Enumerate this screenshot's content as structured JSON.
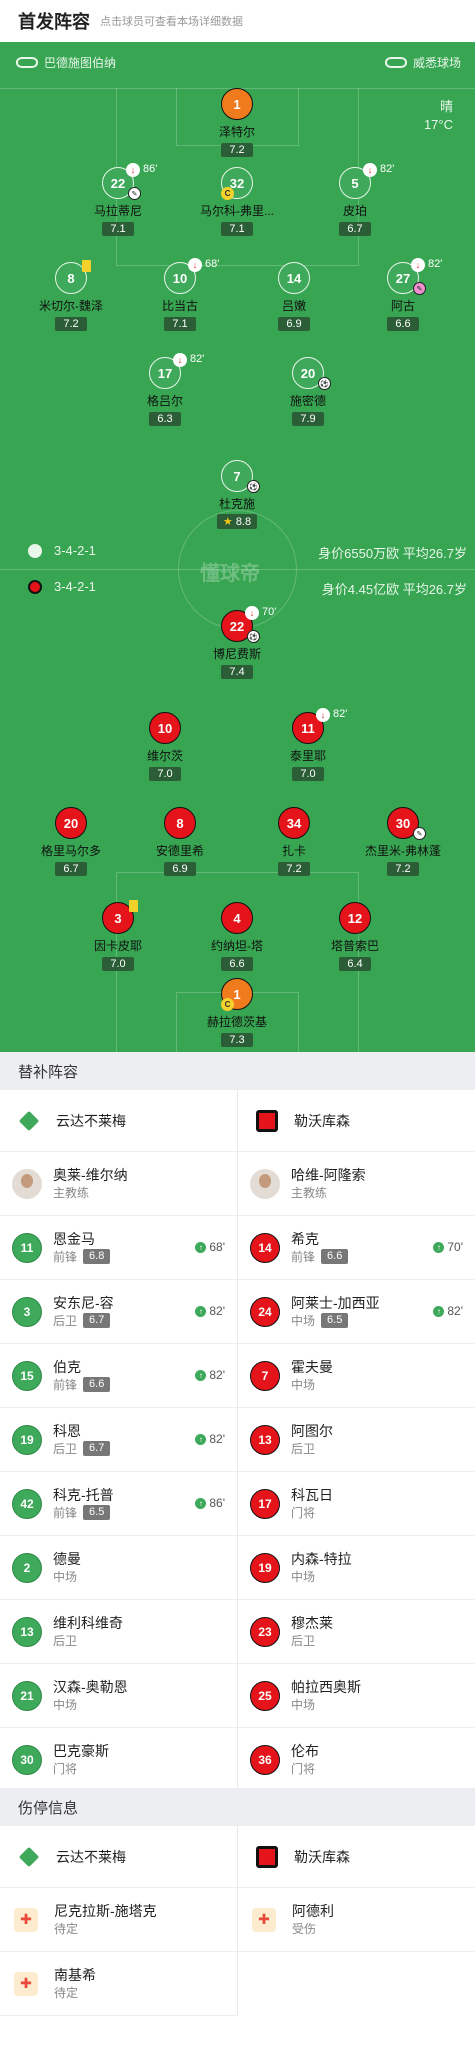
{
  "header": {
    "title": "首发阵容",
    "subtitle": "点击球员可查看本场详细数据"
  },
  "pitch": {
    "home_venue": "巴德施图伯纳",
    "away_venue": "威悉球场",
    "weather": "晴",
    "temperature": "17°C",
    "watermark": "懂球帝",
    "home_formation": "3-4-2-1",
    "away_formation": "3-4-2-1",
    "home_stats": "身价6550万欧 平均26.7岁",
    "away_stats": "身价4.45亿欧 平均26.7岁"
  },
  "home_lineup": [
    {
      "num": "1",
      "name": "泽特尔",
      "rating": "7.2"
    },
    {
      "num": "22",
      "name": "马拉蒂尼",
      "rating": "7.1",
      "sub": "86'"
    },
    {
      "num": "32",
      "name": "马尔科-弗里...",
      "rating": "7.1"
    },
    {
      "num": "5",
      "name": "皮珀",
      "rating": "6.7",
      "sub": "82'"
    },
    {
      "num": "8",
      "name": "米切尔-魏泽",
      "rating": "7.2"
    },
    {
      "num": "10",
      "name": "比当古",
      "rating": "7.1",
      "sub": "68'"
    },
    {
      "num": "14",
      "name": "吕嫩",
      "rating": "6.9"
    },
    {
      "num": "27",
      "name": "阿古",
      "rating": "6.6",
      "sub": "82'"
    },
    {
      "num": "17",
      "name": "格吕尔",
      "rating": "6.3",
      "sub": "82'"
    },
    {
      "num": "20",
      "name": "施密德",
      "rating": "7.9"
    },
    {
      "num": "7",
      "name": "杜克施",
      "rating": "8.8"
    }
  ],
  "away_lineup": [
    {
      "num": "22",
      "name": "博尼费斯",
      "rating": "7.4",
      "sub": "70'"
    },
    {
      "num": "10",
      "name": "维尔茨",
      "rating": "7.0"
    },
    {
      "num": "11",
      "name": "泰里耶",
      "rating": "7.0",
      "sub": "82'"
    },
    {
      "num": "20",
      "name": "格里马尔多",
      "rating": "6.7"
    },
    {
      "num": "8",
      "name": "安德里希",
      "rating": "6.9"
    },
    {
      "num": "34",
      "name": "扎卡",
      "rating": "7.2"
    },
    {
      "num": "30",
      "name": "杰里米-弗林蓬",
      "rating": "7.2"
    },
    {
      "num": "3",
      "name": "因卡皮耶",
      "rating": "7.0"
    },
    {
      "num": "4",
      "name": "约纳坦-塔",
      "rating": "6.6"
    },
    {
      "num": "12",
      "name": "塔普索巴",
      "rating": "6.4"
    },
    {
      "num": "1",
      "name": "赫拉德茨基",
      "rating": "7.3"
    }
  ],
  "subs": {
    "title": "替补阵容",
    "home_team": "云达不莱梅",
    "away_team": "勒沃库森",
    "home_coach": {
      "name": "奥莱-维尔纳",
      "role": "主教练"
    },
    "away_coach": {
      "name": "哈维-阿隆索",
      "role": "主教练"
    },
    "home": [
      {
        "num": "11",
        "name": "恩金马",
        "pos": "前锋",
        "rating": "6.8",
        "min": "68'"
      },
      {
        "num": "3",
        "name": "安东尼-容",
        "pos": "后卫",
        "rating": "6.7",
        "min": "82'"
      },
      {
        "num": "15",
        "name": "伯克",
        "pos": "前锋",
        "rating": "6.6",
        "min": "82'"
      },
      {
        "num": "19",
        "name": "科恩",
        "pos": "后卫",
        "rating": "6.7",
        "min": "82'"
      },
      {
        "num": "42",
        "name": "科克-托普",
        "pos": "前锋",
        "rating": "6.5",
        "min": "86'"
      },
      {
        "num": "2",
        "name": "德曼",
        "pos": "中场"
      },
      {
        "num": "13",
        "name": "维利科维奇",
        "pos": "后卫"
      },
      {
        "num": "21",
        "name": "汉森-奥勒恩",
        "pos": "中场"
      },
      {
        "num": "30",
        "name": "巴克豪斯",
        "pos": "门将"
      }
    ],
    "away": [
      {
        "num": "14",
        "name": "希克",
        "pos": "前锋",
        "rating": "6.6",
        "min": "70'"
      },
      {
        "num": "24",
        "name": "阿莱士-加西亚",
        "pos": "中场",
        "rating": "6.5",
        "min": "82'"
      },
      {
        "num": "7",
        "name": "霍夫曼",
        "pos": "中场"
      },
      {
        "num": "13",
        "name": "阿图尔",
        "pos": "后卫"
      },
      {
        "num": "17",
        "name": "科瓦日",
        "pos": "门将"
      },
      {
        "num": "19",
        "name": "内森-特拉",
        "pos": "中场"
      },
      {
        "num": "23",
        "name": "穆杰莱",
        "pos": "后卫"
      },
      {
        "num": "25",
        "name": "帕拉西奥斯",
        "pos": "中场"
      },
      {
        "num": "36",
        "name": "伦布",
        "pos": "门将"
      }
    ]
  },
  "injuries": {
    "title": "伤停信息",
    "home_team": "云达不莱梅",
    "away_team": "勒沃库森",
    "home": [
      {
        "name": "尼克拉斯-施塔克",
        "status": "待定"
      },
      {
        "name": "南基希",
        "status": "待定"
      }
    ],
    "away": [
      {
        "name": "阿德利",
        "status": "受伤"
      }
    ]
  },
  "colors": {
    "pitch": "#37a551",
    "home": "#3ea95a",
    "away": "#e4141a",
    "gk": "#f07b1d",
    "card": "#f5d22b"
  }
}
